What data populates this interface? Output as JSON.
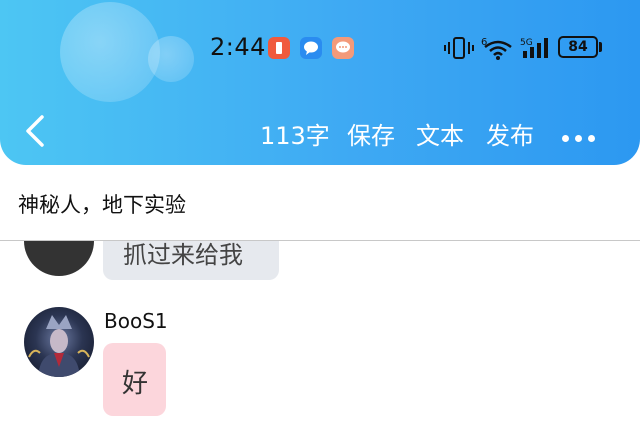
{
  "status_bar": {
    "time": "2:44",
    "battery": "84",
    "network_label": "5G",
    "wifi_label": "6"
  },
  "toolbar": {
    "word_count": "113字",
    "save_label": "保存",
    "text_label": "文本",
    "publish_label": "发布"
  },
  "document": {
    "title": "神秘人，地下实验"
  },
  "messages": [
    {
      "text": "抓过来给我"
    },
    {
      "name": "BooS1",
      "text": "好"
    }
  ],
  "colors": {
    "header_gradient_start": "#4dc6f3",
    "header_gradient_end": "#2c98f1",
    "bubble_gray": "#e6e9ee",
    "bubble_pink": "#fcd6dc"
  }
}
